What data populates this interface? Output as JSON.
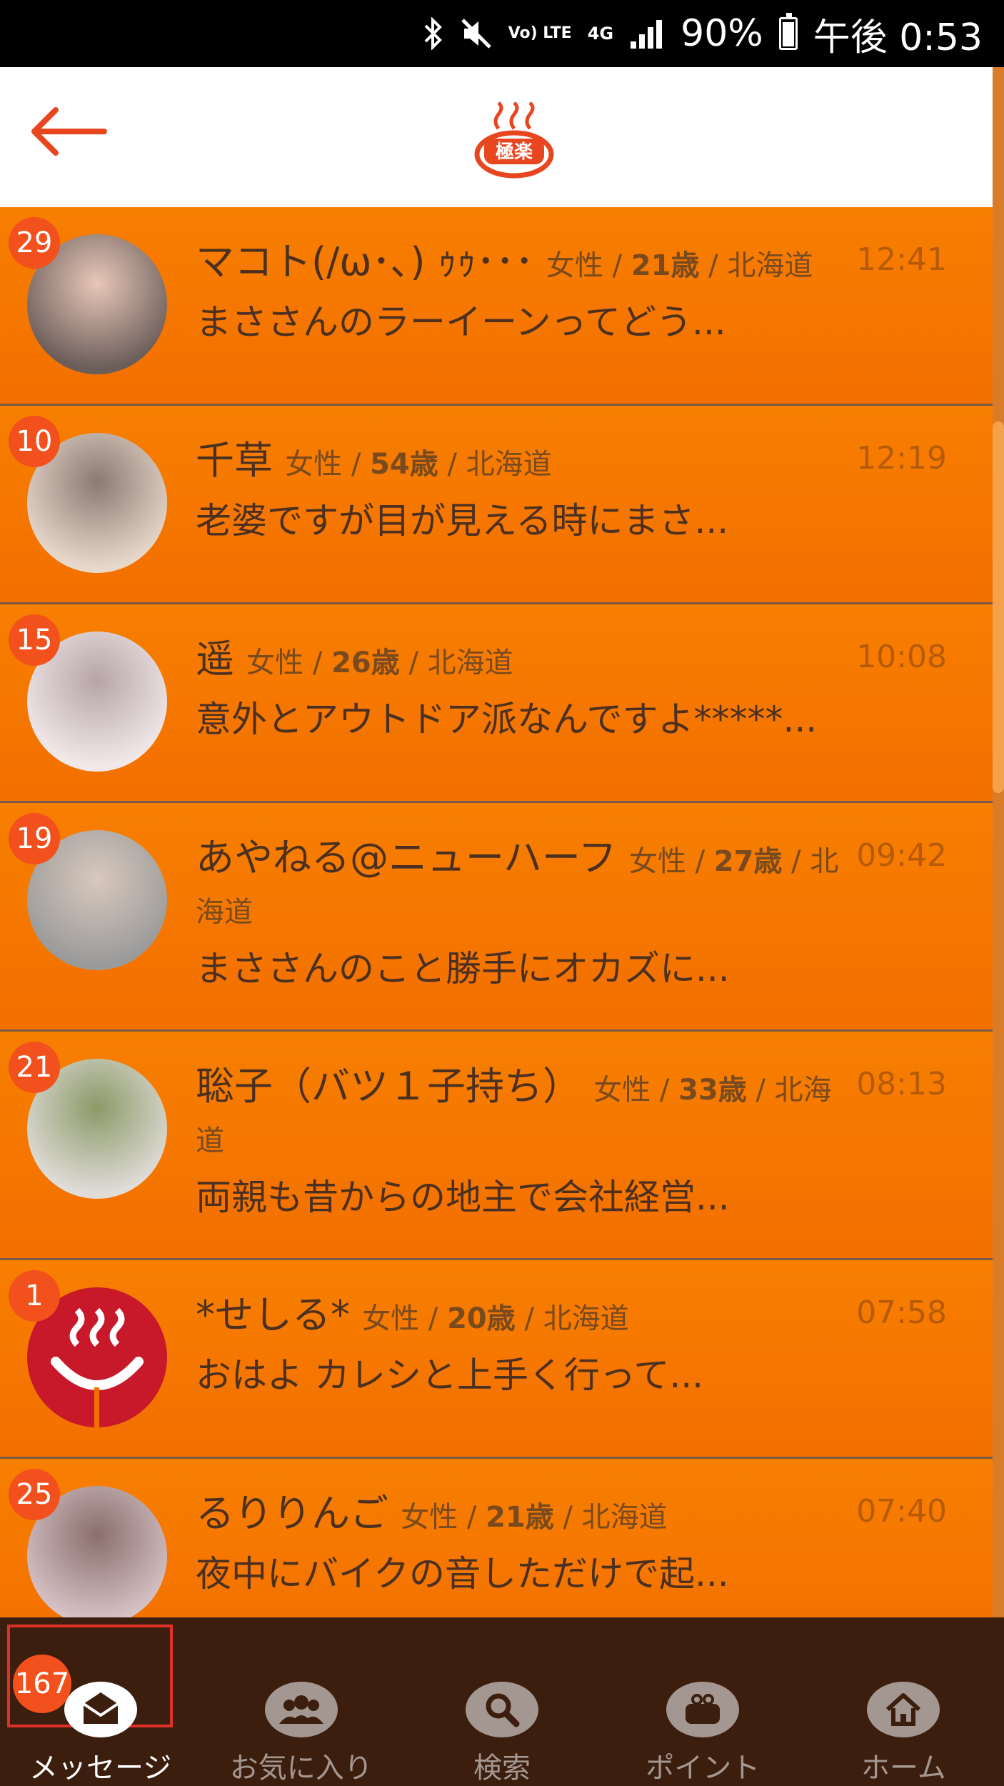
{
  "status_bar": {
    "volte_label": "Vo) LTE",
    "network_label": "4G",
    "battery_text": "90%",
    "time": "午後 0:53"
  },
  "header": {
    "logo_text": "極楽"
  },
  "messages": [
    {
      "badge": "29",
      "name": "マコト(/ω･､) ｩｩ･･･",
      "gender": "女性",
      "age": "21歳",
      "region": "北海道",
      "preview": "まささんのラーイーンってどう...",
      "time": "12:41",
      "avatar_colors": [
        "#6b5d5a",
        "#e8c7b8"
      ]
    },
    {
      "badge": "10",
      "name": "千草",
      "gender": "女性",
      "age": "54歳",
      "region": "北海道",
      "preview": "老婆ですが目が見える時にまさ...",
      "time": "12:19",
      "avatar_colors": [
        "#e8d8cc",
        "#8a7a72"
      ]
    },
    {
      "badge": "15",
      "name": "遥",
      "gender": "女性",
      "age": "26歳",
      "region": "北海道",
      "preview": "意外とアウトドア派なんですよ*****...",
      "time": "10:08",
      "avatar_colors": [
        "#f2e8ea",
        "#b6a5a8"
      ]
    },
    {
      "badge": "19",
      "name": "あやねる@ニューハーフ",
      "gender": "女性",
      "age": "27歳",
      "region": "北海道",
      "preview": "まささんのこと勝手にオカズに...",
      "time": "09:42",
      "avatar_colors": [
        "#9a9a9a",
        "#d8c8bc"
      ]
    },
    {
      "badge": "21",
      "name": "聡子（バツ１子持ち）",
      "gender": "女性",
      "age": "33歳",
      "region": "北海道",
      "preview": "両親も昔からの地主で会社経営...",
      "time": "08:13",
      "avatar_colors": [
        "#e0dcd8",
        "#8c9a68"
      ]
    },
    {
      "badge": "1",
      "name": "*せしる*",
      "gender": "女性",
      "age": "20歳",
      "region": "北海道",
      "preview": "おはよ カレシと上手く行って...",
      "time": "07:58",
      "avatar_colors": [
        "#c8192b",
        "#c8192b"
      ]
    },
    {
      "badge": "25",
      "name": "るりりんご",
      "gender": "女性",
      "age": "21歳",
      "region": "北海道",
      "preview": "夜中にバイクの音しただけで起...",
      "time": "07:40",
      "avatar_colors": [
        "#d6c2c6",
        "#8a6f6c"
      ]
    }
  ],
  "nav": {
    "message_badge": "167",
    "items": [
      {
        "label": "メッセージ",
        "icon": "envelope-icon",
        "active": true
      },
      {
        "label": "お気に入り",
        "icon": "users-icon",
        "active": false
      },
      {
        "label": "検索",
        "icon": "search-icon",
        "active": false
      },
      {
        "label": "ポイント",
        "icon": "purse-icon",
        "active": false
      },
      {
        "label": "ホーム",
        "icon": "home-icon",
        "active": false
      }
    ]
  }
}
